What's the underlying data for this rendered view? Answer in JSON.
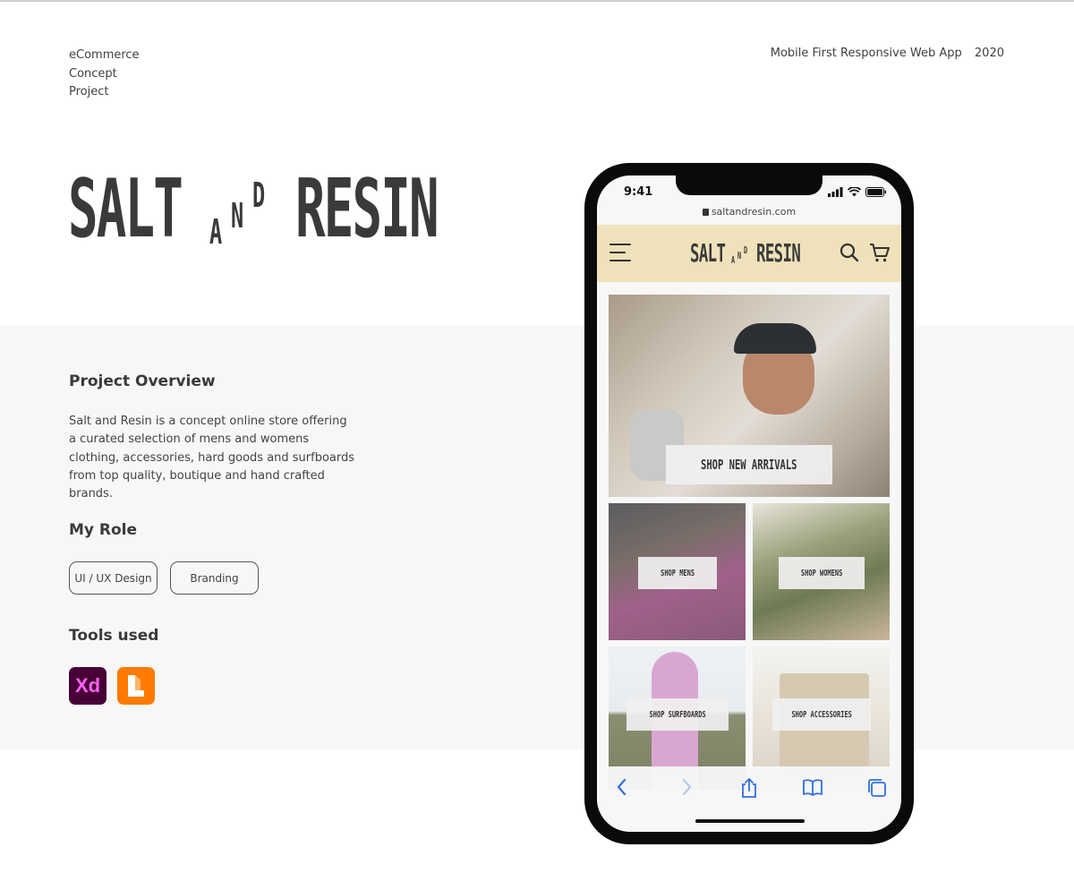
{
  "meta": {
    "left_lines": [
      "eCommerce",
      "Concept",
      "Project"
    ],
    "right_title": "Mobile First Responsive Web App",
    "right_year": "2020"
  },
  "brand": {
    "word1": "SALT",
    "amp_a": "A",
    "amp_n": "N",
    "amp_d": "D",
    "word2": "RESIN"
  },
  "overview": {
    "title": "Project Overview",
    "text": "Salt and Resin is a concept online store offering a curated selection of mens and womens clothing, accessories, hard goods and surfboards from top quality, boutique and hand crafted brands."
  },
  "role": {
    "title": "My Role",
    "tags": [
      "UI / UX Design",
      "Branding"
    ]
  },
  "tools": {
    "title": "Tools used",
    "items": [
      {
        "name": "adobe-xd-icon",
        "label": "Xd",
        "color": "#470137"
      },
      {
        "name": "lunacy-icon",
        "color": "#ff7a00"
      }
    ]
  },
  "phone": {
    "time": "9:41",
    "url": "saltandresin.com",
    "appbar_color": "#efe2ba",
    "tiles": {
      "hero": "SHOP NEW ARRIVALS",
      "mens": "SHOP MENS",
      "womens": "SHOP WOMENS",
      "surfboards": "SHOP SURFBOARDS",
      "accessories": "SHOP ACCESSORIES"
    }
  }
}
